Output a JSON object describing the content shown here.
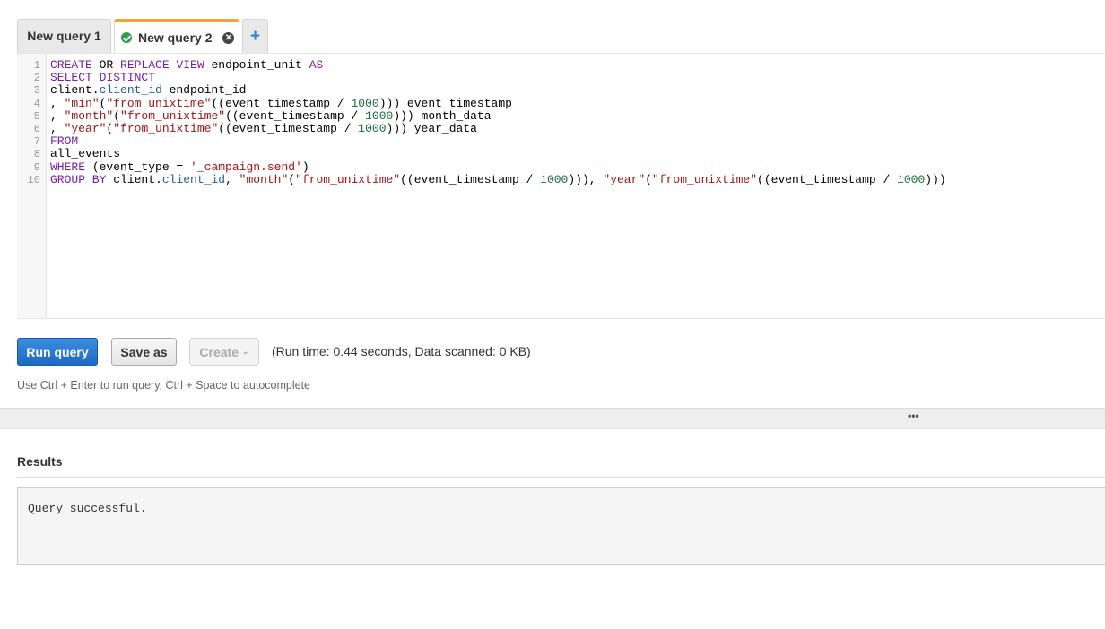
{
  "tabs": [
    {
      "label": "New query 1",
      "active": false
    },
    {
      "label": "New query 2",
      "active": true,
      "status_icon": "check-circle-icon",
      "close_icon": "close-circle-icon"
    }
  ],
  "add_tab_icon": "plus-icon",
  "editor": {
    "line_numbers": [
      "1",
      "2",
      "3",
      "4",
      "5",
      "6",
      "7",
      "8",
      "9",
      "10"
    ]
  },
  "buttons": {
    "run": "Run query",
    "save": "Save as",
    "create": "Create",
    "create_caret_icon": "chevron-down-icon"
  },
  "run_info": "(Run time: 0.44 seconds, Data scanned: 0 KB)",
  "hint": "Use Ctrl + Enter to run query, Ctrl + Space to autocomplete",
  "divider_handle": "•••",
  "results": {
    "title": "Results",
    "message": "Query successful."
  },
  "colors": {
    "active_tab_accent": "#f0a43a",
    "primary_button": "#1e68c4",
    "success_icon": "#2e9e4a",
    "sql_keyword": "#7a1ea1",
    "sql_string": "#a31515",
    "sql_number": "#1a6b3c"
  }
}
